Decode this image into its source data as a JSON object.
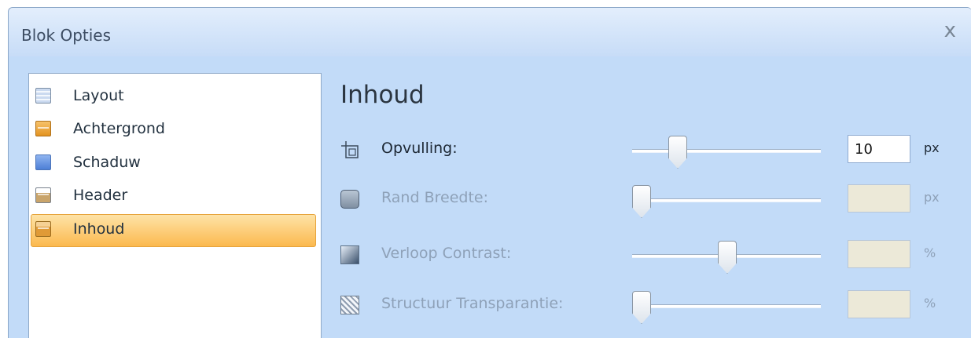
{
  "window": {
    "title": "Blok Opties",
    "close_glyph": "x"
  },
  "nav": {
    "items": [
      {
        "label": "Layout",
        "icon": "layout-icon",
        "selected": false
      },
      {
        "label": "Achtergrond",
        "icon": "achtergrond-icon",
        "selected": false
      },
      {
        "label": "Schaduw",
        "icon": "schaduw-icon",
        "selected": false
      },
      {
        "label": "Header",
        "icon": "header-icon",
        "selected": false
      },
      {
        "label": "Inhoud",
        "icon": "inhoud-icon",
        "selected": true
      }
    ]
  },
  "panel": {
    "title": "Inhoud",
    "rows": [
      {
        "label": "Opvulling:",
        "icon": "opvulling-icon",
        "enabled": true,
        "slider_fraction": 0.21,
        "value": "10",
        "unit": "px"
      },
      {
        "label": "Rand Breedte:",
        "icon": "rand-breedte-icon",
        "enabled": false,
        "slider_fraction": 0.0,
        "value": "",
        "unit": "px"
      },
      {
        "label": "Verloop Contrast:",
        "icon": "verloop-contrast-icon",
        "enabled": false,
        "slider_fraction": 0.5,
        "value": "",
        "unit": "%"
      },
      {
        "label": "Structuur Transparantie:",
        "icon": "structuur-transparantie-icon",
        "enabled": false,
        "slider_fraction": 0.0,
        "value": "",
        "unit": "%"
      }
    ]
  },
  "colors": {
    "window_bg": "#c2dbf8",
    "selected_item": "#fdd07f",
    "disabled_text": "#8ea1b8",
    "disabled_input": "#ece9d8"
  }
}
